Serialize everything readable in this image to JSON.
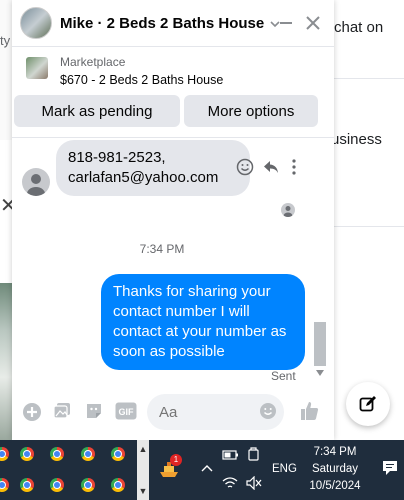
{
  "background": {
    "partial_text_chat_on": "chat on",
    "partial_text_business": "usiness",
    "partial_text_left": "ty"
  },
  "chat": {
    "title": "Mike · 2 Beds 2 Baths House",
    "marketplace_label": "Marketplace",
    "listing_title": "$670 - 2 Beds 2 Baths House",
    "buttons": {
      "mark_pending": "Mark as pending",
      "more_options": "More options"
    },
    "incoming_message": {
      "line1": "818-981-2523,",
      "line2": "carlafan5@yahoo.com"
    },
    "timestamp": "7:34 PM",
    "outgoing_message": "Thanks for sharing your contact number I will contact at your number as soon as possible",
    "status": "Sent",
    "composer_placeholder": "Aa"
  },
  "taskbar": {
    "language": "ENG",
    "time": "7:34 PM",
    "day": "Saturday",
    "date": "10/5/2024",
    "badge_count": "1"
  },
  "colors": {
    "accent": "#0084ff",
    "incoming_bubble": "#e4e6eb",
    "taskbar": "#1f2d3d"
  }
}
